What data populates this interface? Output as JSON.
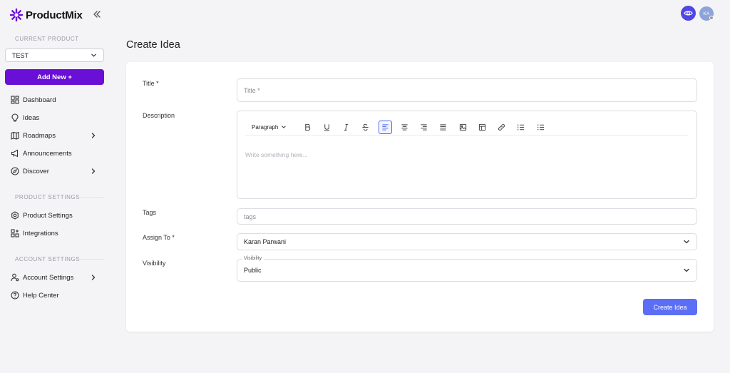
{
  "brand": {
    "name": "ProductMix",
    "accent": "#6a0fd6"
  },
  "sidebar": {
    "current_product_label": "CURRENT PRODUCT",
    "product_value": "TEST",
    "add_new_label": "Add New +",
    "items": [
      {
        "label": "Dashboard",
        "icon": "dashboard-icon"
      },
      {
        "label": "Ideas",
        "icon": "lightbulb-icon"
      },
      {
        "label": "Roadmaps",
        "icon": "map-icon"
      },
      {
        "label": "Announcements",
        "icon": "megaphone-icon"
      },
      {
        "label": "Discover",
        "icon": "compass-icon"
      }
    ],
    "product_settings_label": "PRODUCT SETTINGS",
    "product_items": [
      {
        "label": "Product Settings",
        "icon": "settings-icon"
      },
      {
        "label": "Integrations",
        "icon": "integrations-icon"
      }
    ],
    "account_settings_label": "ACCOUNT SETTINGS",
    "account_items": [
      {
        "label": "Account Settings",
        "icon": "user-gear-icon"
      },
      {
        "label": "Help Center",
        "icon": "help-icon"
      }
    ]
  },
  "header": {
    "avatar_initials": "KA"
  },
  "page": {
    "title": "Create Idea"
  },
  "form": {
    "title_label": "Title *",
    "title_placeholder": "Title *",
    "description_label": "Description",
    "paragraph_value": "Paragraph",
    "editor_placeholder": "Write something here...",
    "tags_label": "Tags",
    "tags_placeholder": "tags",
    "assign_label": "Assign To *",
    "assign_value": "Karan Parwani",
    "visibility_label": "Visibility",
    "visibility_legend": "Visibility",
    "visibility_value": "Public",
    "submit_label": "Create Idea"
  }
}
